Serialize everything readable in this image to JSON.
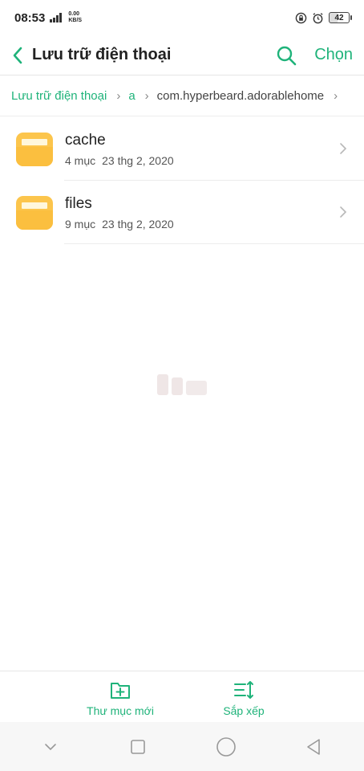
{
  "status_bar": {
    "time": "08:53",
    "net_speed_value": "0.00",
    "net_speed_unit": "KB/S",
    "battery": "42"
  },
  "header": {
    "title": "Lưu trữ điện thoại",
    "select_label": "Chọn"
  },
  "breadcrumb": {
    "items": [
      "Lưu trữ điện thoại",
      "a",
      "com.hyperbeard.adorablehome"
    ]
  },
  "files": [
    {
      "name": "cache",
      "count": "4 mục",
      "date": "23 thg 2, 2020"
    },
    {
      "name": "files",
      "count": "9 mục",
      "date": "23 thg 2, 2020"
    }
  ],
  "toolbar": {
    "new_folder_label": "Thư mục mới",
    "sort_label": "Sắp xếp"
  },
  "colors": {
    "accent": "#1fb37a",
    "folder": "#fcc54c"
  }
}
